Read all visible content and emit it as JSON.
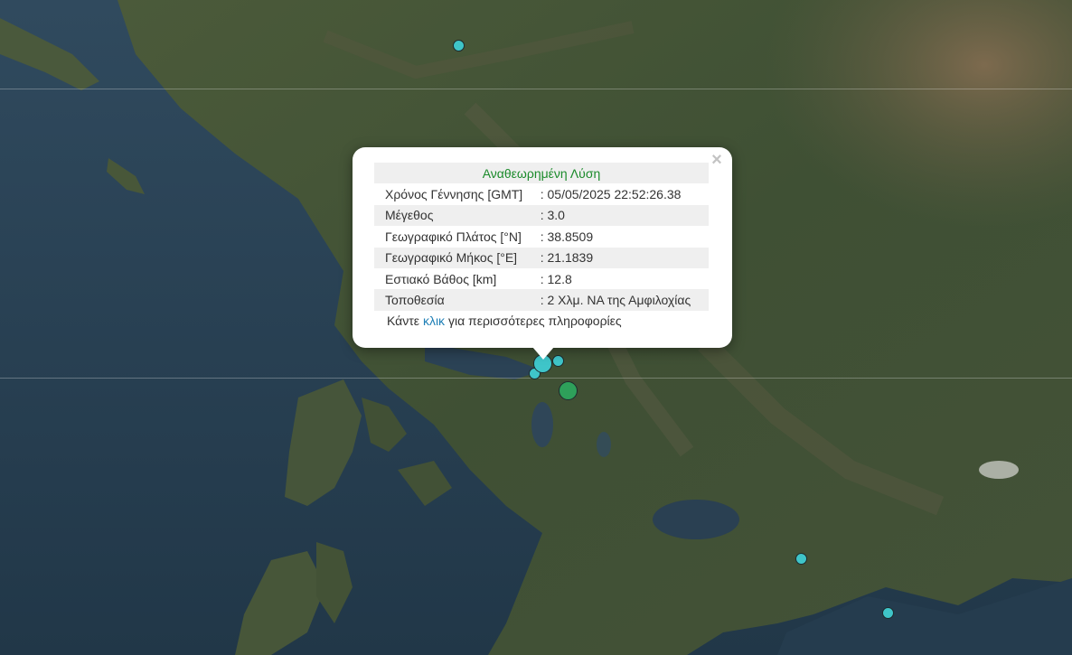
{
  "popup": {
    "title": "Αναθεωρημένη Λύση",
    "close_symbol": "×",
    "rows": [
      {
        "label": "Χρόνος Γέννησης [GMT]",
        "value": ": 05/05/2025 22:52:26.38"
      },
      {
        "label": "Μέγεθος",
        "value": ": 3.0"
      },
      {
        "label": "Γεωγραφικό Πλάτος [°N]",
        "value": ": 38.8509"
      },
      {
        "label": "Γεωγραφικό Μήκος [°E]",
        "value": ": 21.1839"
      },
      {
        "label": "Εστιακό Βάθος [km]",
        "value": ": 12.8"
      },
      {
        "label": "Τοποθεσία",
        "value": ": 2 Χλμ. ΝΑ της Αμφιλοχίας"
      }
    ],
    "more_prefix": "Κάντε",
    "more_link": "κλικ",
    "more_suffix": "για περισσότερες πληροφορίες"
  },
  "colors": {
    "marker_cyan": "#3fc5c9",
    "marker_green": "#2ea05a",
    "title_green": "#1a8a2a",
    "link_blue": "#1f7fb6"
  }
}
